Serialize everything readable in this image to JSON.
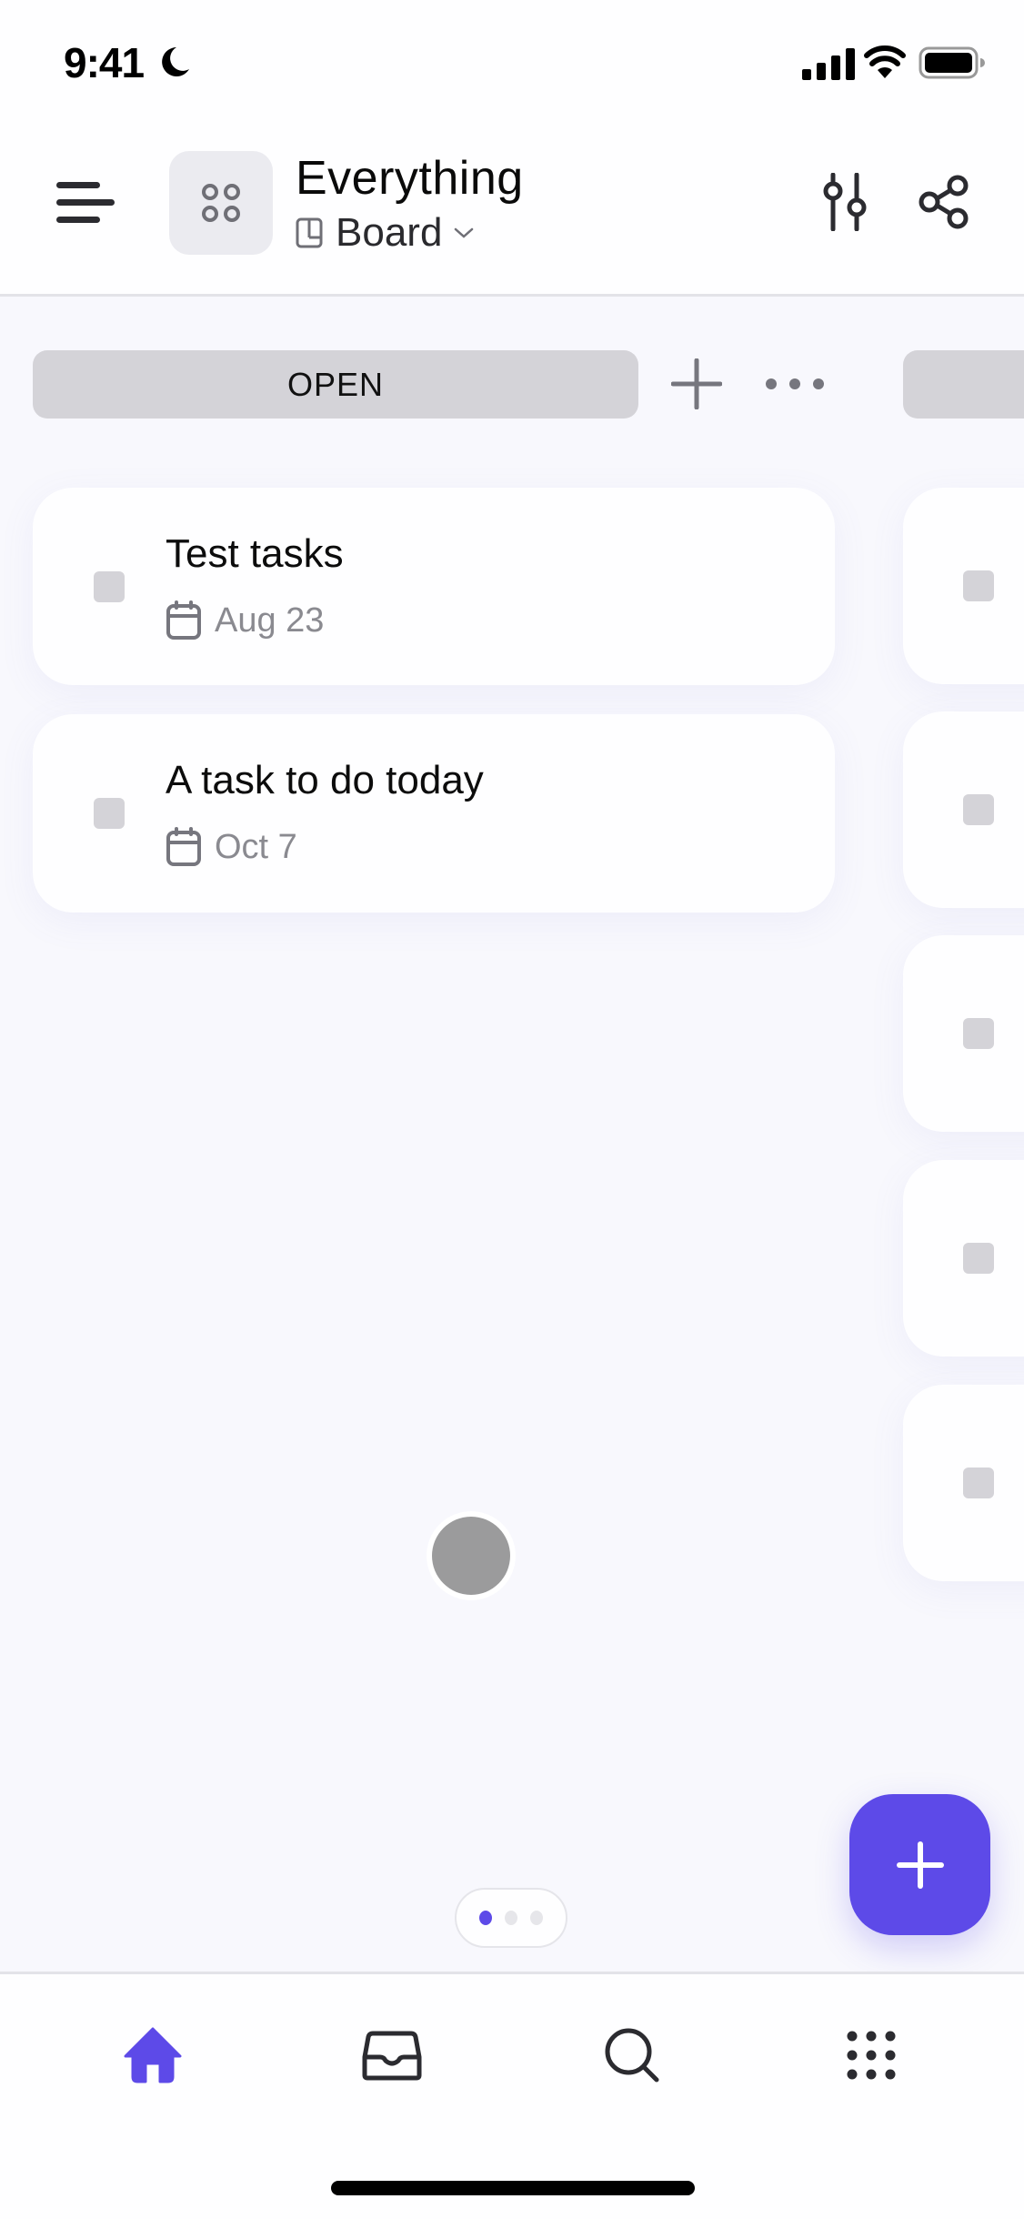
{
  "status_bar": {
    "time": "9:41",
    "focus_icon": "moon-icon",
    "signal_icon": "cellular-signal-icon",
    "wifi_icon": "wifi-icon",
    "battery_icon": "battery-full-icon"
  },
  "header": {
    "menu_icon": "hamburger-menu-icon",
    "space_icon": "four-circles-icon",
    "title": "Everything",
    "view": {
      "icon": "board-view-icon",
      "label": "Board",
      "chevron": "chevron-down-icon"
    },
    "actions": [
      {
        "name": "filter",
        "icon": "sliders-filter-icon"
      },
      {
        "name": "share",
        "icon": "share-icon"
      }
    ]
  },
  "board": {
    "columns": [
      {
        "title": "OPEN",
        "add_icon": "plus-icon",
        "more_icon": "more-horizontal-icon",
        "tasks": [
          {
            "title": "Test tasks",
            "date": "Aug 23",
            "date_icon": "calendar-icon",
            "checked": false
          },
          {
            "title": "A task to do today",
            "date": "Oct 7",
            "date_icon": "calendar-icon",
            "checked": false
          }
        ]
      },
      {
        "title": "",
        "tasks_visible": 5
      }
    ],
    "pager": {
      "pages": 3,
      "active": 1
    }
  },
  "fab": {
    "icon": "plus-icon",
    "color": "#5D4AE8"
  },
  "bottom_nav": {
    "items": [
      {
        "name": "home",
        "icon": "home-icon",
        "active": true
      },
      {
        "name": "inbox",
        "icon": "inbox-icon",
        "active": false
      },
      {
        "name": "search",
        "icon": "search-icon",
        "active": false
      },
      {
        "name": "more",
        "icon": "grid-dots-icon",
        "active": false
      }
    ]
  },
  "colors": {
    "accent": "#5D4AE8",
    "background": "#F8F8FD",
    "column_header": "#D4D3D8",
    "muted_text": "#8A8A90"
  }
}
